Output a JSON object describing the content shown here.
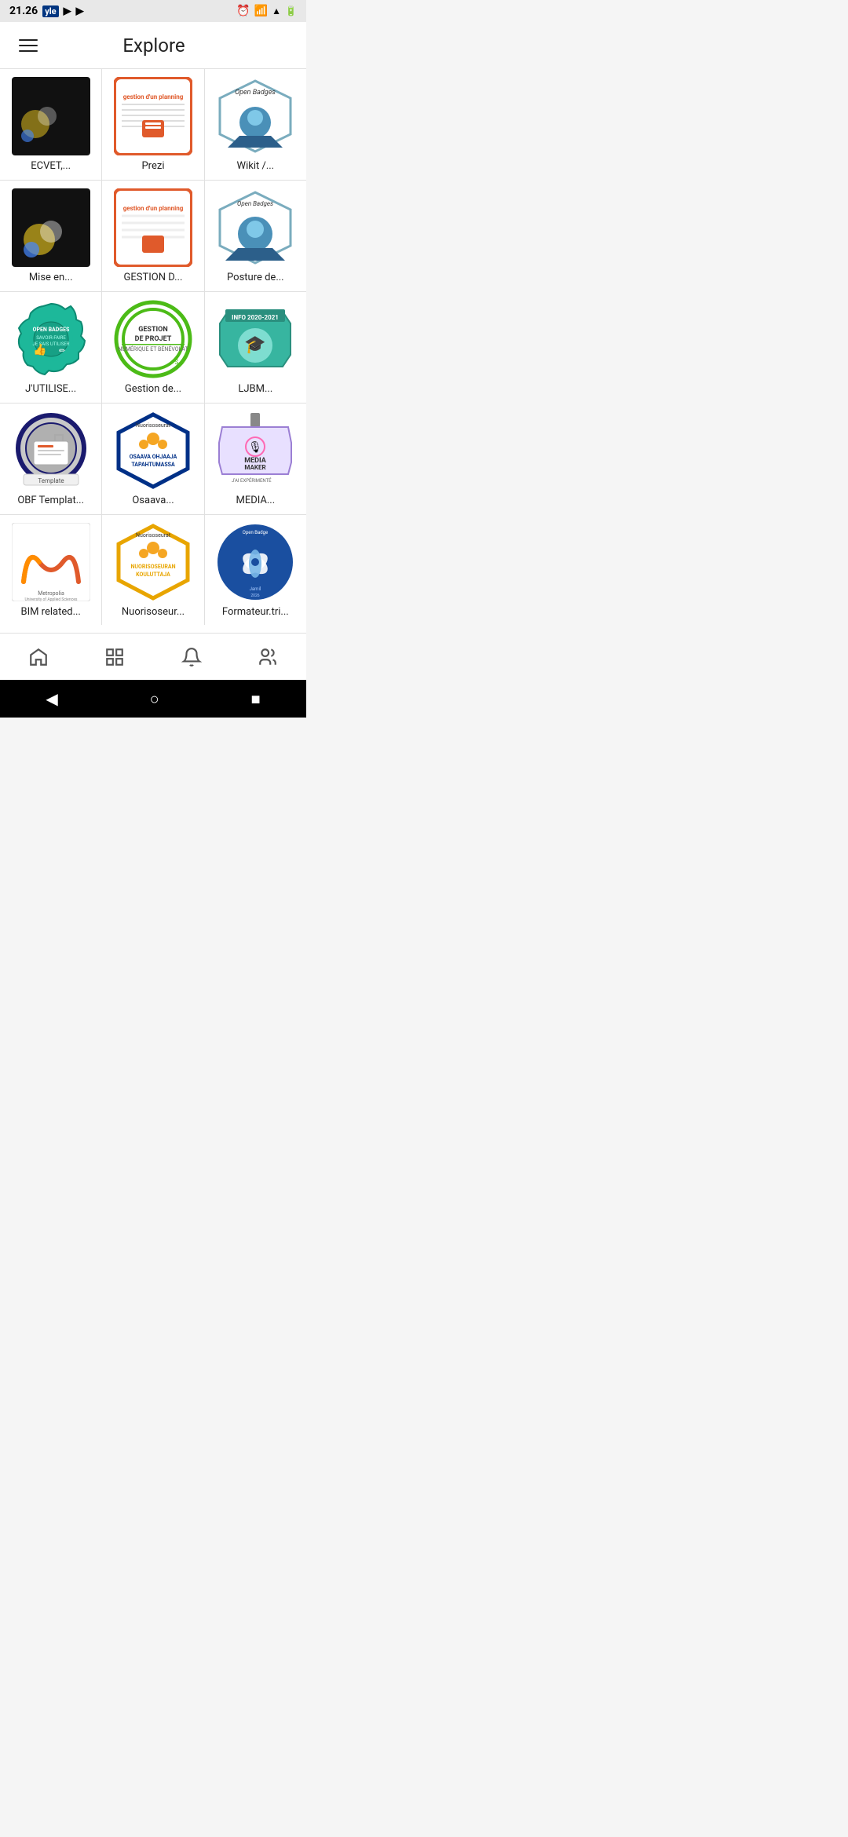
{
  "statusBar": {
    "time": "21.26",
    "apps": [
      "yle",
      "yt1",
      "yt2"
    ],
    "icons": [
      "alarm",
      "wifi",
      "signal",
      "battery"
    ]
  },
  "header": {
    "menu_label": "menu",
    "title": "Explore"
  },
  "grid": {
    "items": [
      {
        "id": "ecvet",
        "label": "ECVET,...",
        "badgeClass": "badge-ecvet"
      },
      {
        "id": "prezi",
        "label": "Prezi",
        "badgeClass": "badge-prezi"
      },
      {
        "id": "wikit",
        "label": "Wikit /...",
        "badgeClass": "badge-wikit"
      },
      {
        "id": "mise-en",
        "label": "Mise en...",
        "badgeClass": "badge-ecvet"
      },
      {
        "id": "gestion-d",
        "label": "GESTION D...",
        "badgeClass": "badge-prezi"
      },
      {
        "id": "posture-de",
        "label": "Posture de...",
        "badgeClass": "badge-wikit"
      },
      {
        "id": "jutilise",
        "label": "J'UTILISE...",
        "badgeClass": "badge-open-badges-use"
      },
      {
        "id": "gestion-de",
        "label": "Gestion de...",
        "badgeClass": "badge-gestion-projet"
      },
      {
        "id": "ljbm",
        "label": "LJBM...",
        "badgeClass": "badge-ljbm"
      },
      {
        "id": "obf-template",
        "label": "OBF Templat...",
        "badgeClass": "badge-obf"
      },
      {
        "id": "osaava",
        "label": "Osaava...",
        "badgeClass": "badge-osaava"
      },
      {
        "id": "media",
        "label": "MEDIA...",
        "badgeClass": "badge-media"
      },
      {
        "id": "bim-related",
        "label": "BIM related...",
        "badgeClass": "badge-bim"
      },
      {
        "id": "nuorisoseur",
        "label": "Nuorisoseur...",
        "badgeClass": "badge-nuorisoseuran"
      },
      {
        "id": "formateur",
        "label": "Formateur.tri...",
        "badgeClass": "badge-formateur"
      }
    ]
  },
  "bottomNav": {
    "items": [
      {
        "id": "home",
        "icon": "home",
        "label": "Home"
      },
      {
        "id": "grid",
        "icon": "grid",
        "label": "Grid"
      },
      {
        "id": "bell",
        "icon": "bell",
        "label": "Notifications"
      },
      {
        "id": "people",
        "icon": "people",
        "label": "People"
      }
    ]
  },
  "navBar": {
    "back": "◀",
    "home": "○",
    "recent": "■"
  }
}
